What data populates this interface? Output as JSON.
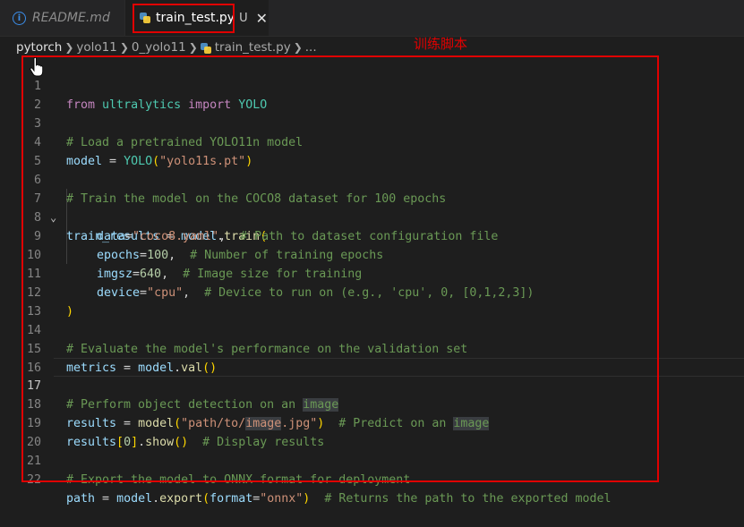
{
  "tabs": [
    {
      "label": "README.md",
      "icon": "info-icon"
    },
    {
      "label": "train_test.py",
      "icon": "python-file-icon",
      "status": "U",
      "close": "✕"
    }
  ],
  "breadcrumb": [
    "pytorch",
    "yolo11",
    "0_yolo11",
    "train_test.py",
    "..."
  ],
  "annotation": "训练脚本",
  "code": {
    "line_numbers": [
      "1",
      "2",
      "3",
      "4",
      "5",
      "6",
      "7",
      "8",
      "9",
      "10",
      "11",
      "12",
      "13",
      "14",
      "15",
      "16",
      "17",
      "18",
      "19",
      "20",
      "21",
      "22"
    ],
    "l1": {
      "kw1": "from",
      "mod": "ultralytics",
      "kw2": "import",
      "cls": "YOLO"
    },
    "l3": "# Load a pretrained YOLO11n model",
    "l4": {
      "var": "model",
      "op": " = ",
      "fn": "YOLO",
      "p1": "(",
      "str": "\"yolo11s.pt\"",
      "p2": ")"
    },
    "l6": "# Train the model on the COCO8 dataset for 100 epochs",
    "l7": {
      "var": "train_results",
      "op": " = ",
      "obj": "model",
      "dot": ".",
      "fn": "train",
      "p": "("
    },
    "l8": {
      "arg": "data",
      "eq": "=",
      "str": "\"coco8.yaml\"",
      "sep": ",  ",
      "cm": "# Path to dataset configuration file"
    },
    "l9": {
      "arg": "epochs",
      "eq": "=",
      "num": "100",
      "sep": ",  ",
      "cm": "# Number of training epochs"
    },
    "l10": {
      "arg": "imgsz",
      "eq": "=",
      "num": "640",
      "sep": ",  ",
      "cm": "# Image size for training"
    },
    "l11": {
      "arg": "device",
      "eq": "=",
      "str": "\"cpu\"",
      "sep": ",  ",
      "cm": "# Device to run on (e.g., 'cpu', 0, [0,1,2,3])"
    },
    "l12": ")",
    "l14": "# Evaluate the model's performance on the validation set",
    "l15": {
      "var": "metrics",
      "op": " = ",
      "obj": "model",
      "dot": ".",
      "fn": "val",
      "p": "()"
    },
    "l17": {
      "cm": "# Perform object detection on an ",
      "hl": "image"
    },
    "l18": {
      "var": "results",
      "op": " = ",
      "fn": "model",
      "p1": "(",
      "s1": "\"path/to/",
      "shl": "image",
      "s2": ".jpg\"",
      "p2": ")",
      "sep": "  ",
      "cm": "# Predict on an ",
      "chl": "image"
    },
    "l19": {
      "var": "results",
      "b1": "[",
      "num": "0",
      "b2": "]",
      "dot": ".",
      "fn": "show",
      "p": "()",
      "sep": "  ",
      "cm": "# Display results"
    },
    "l21": "# Export the model to ONNX format for deployment",
    "l22": {
      "var": "path",
      "op": " = ",
      "obj": "model",
      "dot": ".",
      "fn": "export",
      "p1": "(",
      "arg": "format",
      "eq": "=",
      "str": "\"onnx\"",
      "p2": ")",
      "sep": "  ",
      "cm": "# Returns the path to the exported model"
    }
  },
  "colors": {
    "annotation_red": "#e00000",
    "editor_bg": "#1e1e1e",
    "comment": "#6a9955",
    "keyword": "#c586c0"
  }
}
